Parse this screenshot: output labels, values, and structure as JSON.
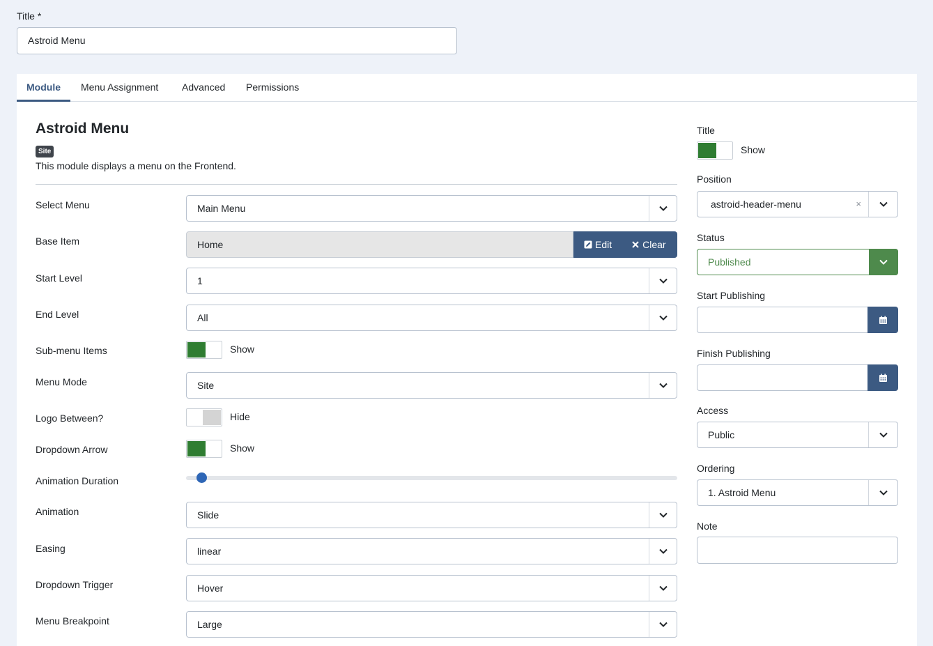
{
  "title_field": {
    "label": "Title *",
    "value": "Astroid Menu"
  },
  "tabs": [
    {
      "label": "Module"
    },
    {
      "label": "Menu Assignment"
    },
    {
      "label": "Advanced"
    },
    {
      "label": "Permissions"
    }
  ],
  "module": {
    "title": "Astroid Menu",
    "badge": "Site",
    "description": "This module displays a menu on the Frontend."
  },
  "fields": {
    "select_menu": {
      "label": "Select Menu",
      "value": "Main Menu"
    },
    "base_item": {
      "label": "Base Item",
      "value": "Home",
      "edit_label": "Edit",
      "clear_label": "Clear"
    },
    "start_level": {
      "label": "Start Level",
      "value": "1"
    },
    "end_level": {
      "label": "End Level",
      "value": "All"
    },
    "submenu_items": {
      "label": "Sub-menu Items",
      "state": "Show"
    },
    "menu_mode": {
      "label": "Menu Mode",
      "value": "Site"
    },
    "logo_between": {
      "label": "Logo Between?",
      "state": "Hide"
    },
    "dropdown_arrow": {
      "label": "Dropdown Arrow",
      "state": "Show"
    },
    "animation_duration": {
      "label": "Animation Duration",
      "level": 0.03
    },
    "animation": {
      "label": "Animation",
      "value": "Slide"
    },
    "easing": {
      "label": "Easing",
      "value": "linear"
    },
    "dropdown_trigger": {
      "label": "Dropdown Trigger",
      "value": "Hover"
    },
    "menu_breakpoint": {
      "label": "Menu Breakpoint",
      "value": "Large"
    }
  },
  "sidebar": {
    "title": {
      "label": "Title",
      "state": "Show"
    },
    "position": {
      "label": "Position",
      "value": "astroid-header-menu",
      "clear": "×"
    },
    "status": {
      "label": "Status",
      "value": "Published"
    },
    "start_publishing": {
      "label": "Start Publishing",
      "value": ""
    },
    "finish_publishing": {
      "label": "Finish Publishing",
      "value": ""
    },
    "access": {
      "label": "Access",
      "value": "Public"
    },
    "ordering": {
      "label": "Ordering",
      "value": "1. Astroid Menu"
    },
    "note": {
      "label": "Note",
      "value": ""
    }
  },
  "colors": {
    "primary": "#3c5a82",
    "toggle_on": "#2f7d32",
    "published": "#4e8a4c",
    "slider": "#2e66b6"
  }
}
